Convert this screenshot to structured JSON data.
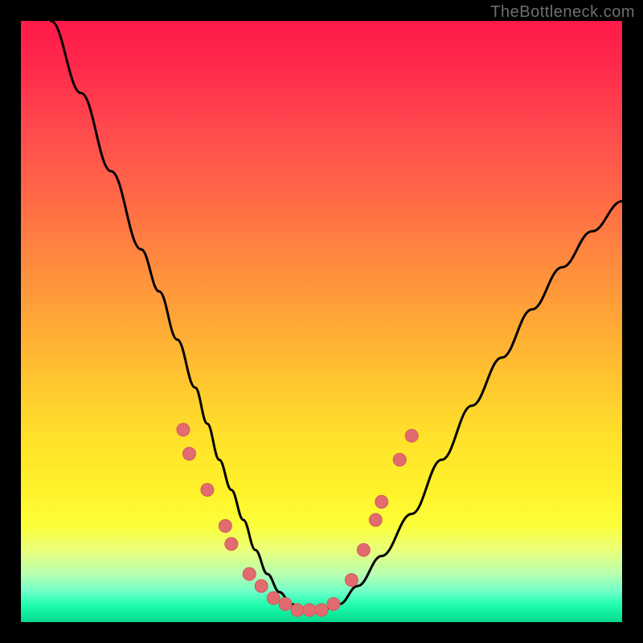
{
  "watermark": "TheBottleneck.com",
  "colors": {
    "curve_stroke": "#000000",
    "marker_fill": "#e16b6e",
    "marker_stroke": "#d35a5d",
    "gradient_top": "#ff1a4a",
    "gradient_bottom": "#07d88e",
    "frame": "#000000"
  },
  "chart_data": {
    "type": "line",
    "title": "",
    "xlabel": "",
    "ylabel": "",
    "xlim": [
      0,
      100
    ],
    "ylim": [
      0,
      100
    ],
    "grid": false,
    "series": [
      {
        "name": "bottleneck-curve",
        "x": [
          5,
          10,
          15,
          20,
          23,
          26,
          29,
          31,
          33,
          35,
          37,
          39,
          41,
          43,
          45,
          47,
          50,
          53,
          56,
          60,
          65,
          70,
          75,
          80,
          85,
          90,
          95,
          100
        ],
        "y": [
          100,
          88,
          75,
          62,
          55,
          47,
          39,
          33,
          27,
          22,
          17,
          12,
          8,
          5,
          3,
          2,
          2,
          3,
          6,
          11,
          18,
          27,
          36,
          44,
          52,
          59,
          65,
          70
        ]
      }
    ],
    "annotations": [
      {
        "type": "markers",
        "on_series": "bottleneck-curve",
        "points": [
          {
            "x": 27,
            "y": 32
          },
          {
            "x": 28,
            "y": 28
          },
          {
            "x": 31,
            "y": 22
          },
          {
            "x": 34,
            "y": 16
          },
          {
            "x": 35,
            "y": 13
          },
          {
            "x": 38,
            "y": 8
          },
          {
            "x": 40,
            "y": 6
          },
          {
            "x": 42,
            "y": 4
          },
          {
            "x": 44,
            "y": 3
          },
          {
            "x": 46,
            "y": 2
          },
          {
            "x": 48,
            "y": 2
          },
          {
            "x": 50,
            "y": 2
          },
          {
            "x": 52,
            "y": 3
          },
          {
            "x": 55,
            "y": 7
          },
          {
            "x": 57,
            "y": 12
          },
          {
            "x": 59,
            "y": 17
          },
          {
            "x": 60,
            "y": 20
          },
          {
            "x": 63,
            "y": 27
          },
          {
            "x": 65,
            "y": 31
          }
        ]
      }
    ]
  }
}
